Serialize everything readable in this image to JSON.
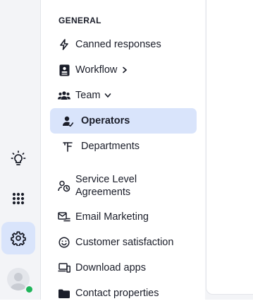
{
  "rail": {
    "icons": [
      "lightbulb-icon",
      "apps-grid-icon",
      "settings-gear-icon",
      "avatar-icon"
    ],
    "active": "settings-gear-icon",
    "presence_status": "online"
  },
  "panel": {
    "section_title": "GENERAL",
    "items": [
      {
        "label": "Canned responses",
        "icon": "lightning-icon"
      },
      {
        "label": "Workflow",
        "icon": "workflow-icon",
        "chevron": "right"
      },
      {
        "label": "Team",
        "icon": "team-icon",
        "chevron": "down",
        "expanded": true
      },
      {
        "label": "Operators",
        "icon": "operator-icon",
        "active": true
      },
      {
        "label": "Departments",
        "icon": "departments-icon"
      },
      {
        "label": "Service Level Agreements",
        "icon": "sla-icon"
      },
      {
        "label": "Email Marketing",
        "icon": "email-marketing-icon"
      },
      {
        "label": "Customer satisfaction",
        "icon": "smiley-icon"
      },
      {
        "label": "Download apps",
        "icon": "devices-icon"
      },
      {
        "label": "Contact properties",
        "icon": "folder-icon"
      }
    ]
  },
  "colors": {
    "active_bg": "#d9e4fb",
    "rail_bg": "#f3f4f7",
    "text": "#1a1d29",
    "presence": "#1fb55a"
  }
}
